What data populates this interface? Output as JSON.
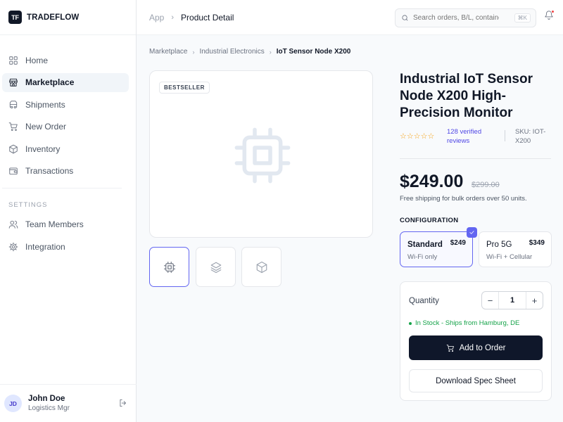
{
  "brand": {
    "logo_text": "TF",
    "name": "TRADEFLOW"
  },
  "sidebar": {
    "items": [
      {
        "label": "Home",
        "icon": "grid-icon"
      },
      {
        "label": "Marketplace",
        "icon": "store-icon",
        "active": true
      },
      {
        "label": "Shipments",
        "icon": "truck-icon"
      },
      {
        "label": "New Order",
        "icon": "cart-icon"
      },
      {
        "label": "Inventory",
        "icon": "box-icon"
      },
      {
        "label": "Transactions",
        "icon": "wallet-icon"
      }
    ],
    "section_label": "SETTINGS",
    "settings_items": [
      {
        "label": "Team Members",
        "icon": "users-icon"
      },
      {
        "label": "Integration",
        "icon": "gear-icon"
      }
    ]
  },
  "user": {
    "initials": "JD",
    "name": "John Doe",
    "role": "Logistics Mgr"
  },
  "topbar": {
    "breadcrumb": [
      "App",
      "Product Detail"
    ],
    "search_placeholder": "Search orders, B/L, containers...",
    "shortcut": "⌘K"
  },
  "breadcrumb": [
    "Marketplace",
    "Industrial Electronics",
    "IoT Sensor Node X200"
  ],
  "product": {
    "badge": "BESTSELLER",
    "title": "Industrial IoT Sensor Node X200 High-Precision Monitor",
    "stars": "☆☆☆☆☆",
    "rating": 0,
    "reviews": "128 verified reviews",
    "sku": "SKU: IOT-X200",
    "price": "$249.00",
    "old_price": "$299.00",
    "shipping_note": "Free shipping for bulk orders over 50 units.",
    "config_label": "CONFIGURATION",
    "options": [
      {
        "name": "Standard",
        "price": "$249",
        "desc": "Wi-Fi only",
        "selected": true
      },
      {
        "name": "Pro 5G",
        "price": "$349",
        "desc": "Wi-Fi + Cellular",
        "selected": false
      }
    ],
    "quantity_label": "Quantity",
    "quantity": "1",
    "minus": "−",
    "plus": "+",
    "stock": "In Stock - Ships from Hamburg, DE",
    "add_button": "Add to Order",
    "spec_button": "Download Spec Sheet",
    "thumbnails": [
      "chip-icon",
      "layers-icon",
      "cube-icon"
    ]
  },
  "colors": {
    "accent": "#6366f1",
    "primary_button": "#0f172a",
    "stock_green": "#16a34a",
    "star": "#f59e0b",
    "link": "#4f46e5"
  }
}
